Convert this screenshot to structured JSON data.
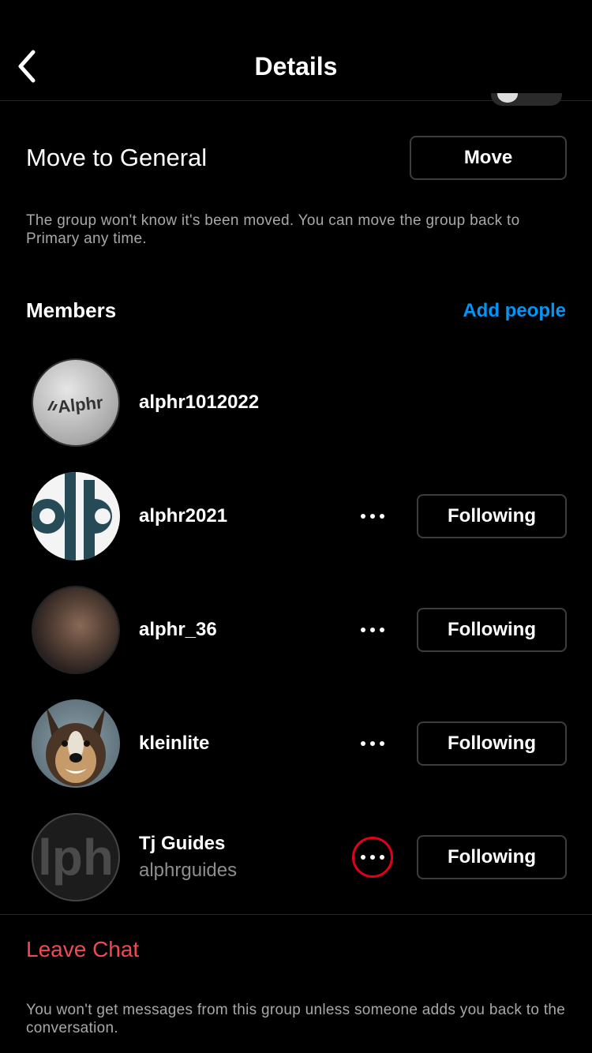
{
  "header": {
    "title": "Details",
    "back_icon": "chevron-left-icon"
  },
  "move_section": {
    "label": "Move to General",
    "button_label": "Move",
    "description": "The group won't know it's been moved. You can move the group back to Primary any time."
  },
  "members": {
    "title": "Members",
    "add_label": "Add people",
    "add_color": "#0095f6",
    "items": [
      {
        "username": "alphr1012022",
        "avatar_text": "Alphr"
      },
      {
        "username": "alphr2021",
        "action": "Following",
        "avatar_text": "alp"
      },
      {
        "username": "alphr_36",
        "action": "Following"
      },
      {
        "username": "kleinlite",
        "action": "Following"
      },
      {
        "username": "Tj Guides",
        "subtitle": "alphrguides",
        "action": "Following",
        "avatar_text": "lph",
        "more_highlighted": true
      }
    ]
  },
  "leave": {
    "label": "Leave Chat",
    "color": "#ed4956",
    "description": "You won't get messages from this group unless someone adds you back to the conversation."
  },
  "colors": {
    "background": "#000000",
    "highlight_ring": "#e0001a"
  }
}
